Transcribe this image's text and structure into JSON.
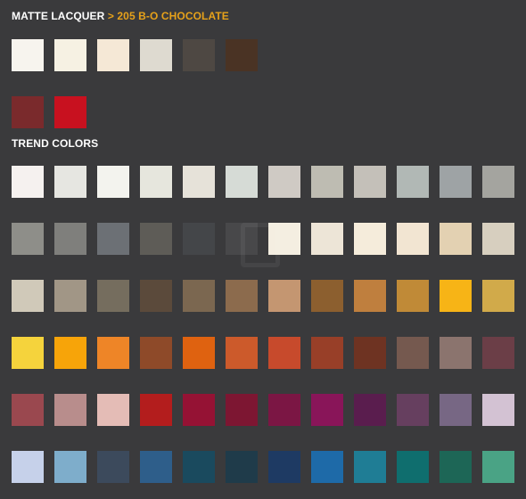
{
  "breadcrumb": {
    "category": "MATTE LACQUER",
    "separator": ">",
    "current": "205 B-O CHOCOLATE"
  },
  "matte_lacquer": {
    "swatches": [
      "#f7f4ee",
      "#f6f1e3",
      "#f5e8d6",
      "#dedad0",
      "#4e4843",
      "#4a3324",
      "#7a2a2c",
      "#c8111f"
    ]
  },
  "trend_colors": {
    "title": "TREND COLORS",
    "rows": [
      [
        "#f5f1ef",
        "#e6e6e1",
        "#f3f3ee",
        "#e6e6dd",
        "#e6e2d9",
        "#d6dbd6",
        "#cfcac4",
        "#bebcb2",
        "#c4c0b9",
        "#b1b8b5",
        "#9ea3a5",
        "#a4a49f"
      ],
      [
        "#8e8e89",
        "#7f7f7c",
        "#6c7075",
        "#5e5c57",
        "#444649",
        "#48484a",
        "#f4eee1",
        "#ede5d7",
        "#f5ecdb",
        "#f2e5d2",
        "#e3d1b2",
        "#d7cfbf"
      ],
      [
        "#d0c9b9",
        "#a19686",
        "#756d5e",
        "#5b4a3b",
        "#7b6750",
        "#8c6b4d",
        "#c49671",
        "#8c5f2f",
        "#bf7f3e",
        "#c08a37",
        "#f7b416",
        "#d1aa4a"
      ],
      [
        "#f5d33c",
        "#f7a409",
        "#ee8527",
        "#8e4a29",
        "#df6210",
        "#cc5a2b",
        "#c74a2c",
        "#983f28",
        "#6e3322",
        "#75594f",
        "#8b746e",
        "#6b3e47"
      ],
      [
        "#9a484f",
        "#b88d8c",
        "#e4bcb6",
        "#b31d1d",
        "#951234",
        "#7d1632",
        "#7b1644",
        "#891559",
        "#5a1d4e",
        "#663f5f",
        "#776784",
        "#d3c2d3"
      ],
      [
        "#c6d1ea",
        "#7eadcb",
        "#3c4a5c",
        "#2e5e8a",
        "#1a4a5e",
        "#1f3b4a",
        "#1e3a63",
        "#1e6aa8",
        "#1f7d95",
        "#0f6e6e",
        "#1d6656",
        "#4aa385"
      ]
    ]
  }
}
